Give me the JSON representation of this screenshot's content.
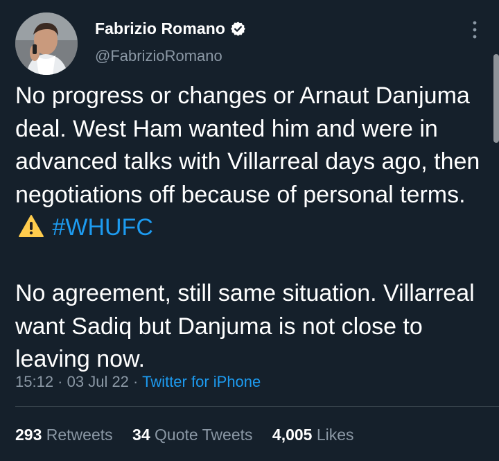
{
  "author": {
    "display_name": "Fabrizio Romano",
    "handle": "@FabrizioRomano",
    "verified_icon": "verified-badge-icon",
    "avatar_icon": "profile-photo"
  },
  "tweet": {
    "paragraph1": {
      "text": "No progress or changes or Arnaut Danjuma deal. West Ham wanted him and were in advanced talks with Villarreal days ago, then negotiations off because of personal terms.",
      "emoji": "⚠️",
      "hashtag": "#WHUFC"
    },
    "paragraph2": "No agreement, still same situation. Villarreal want Sadiq but Danjuma is not close to leaving now."
  },
  "meta": {
    "time": "15:12",
    "separator1": " · ",
    "date": "03 Jul 22",
    "separator2": " · ",
    "source": "Twitter for iPhone"
  },
  "stats": {
    "retweets_count": "293",
    "retweets_label": "Retweets",
    "quotes_count": "34",
    "quotes_label": "Quote Tweets",
    "likes_count": "4,005",
    "likes_label": "Likes"
  },
  "colors": {
    "background": "#15202b",
    "accent": "#1d9bf0",
    "secondary_text": "#8b98a5"
  }
}
